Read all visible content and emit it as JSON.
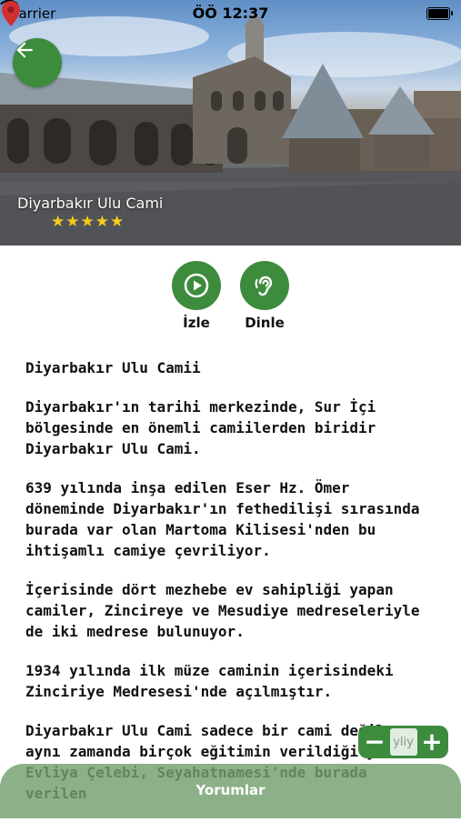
{
  "status_bar": {
    "carrier": "Carrier",
    "time": "ÖÖ 12:37"
  },
  "hero": {
    "place_name": "Diyarbakır Ulu Cami",
    "rating_stars": "★★★★★",
    "rating_value": 5,
    "icons": {
      "back": "arrow-left-icon",
      "location": "location-pin-icon"
    },
    "colors": {
      "accent": "#3d8b3d",
      "star": "#f5cc1a",
      "pin": "#d32f2f"
    }
  },
  "actions": [
    {
      "label": "İzle",
      "icon": "play-circle-icon"
    },
    {
      "label": "Dinle",
      "icon": "ear-icon"
    }
  ],
  "article": {
    "heading": "Diyarbakır Ulu Camii",
    "paragraphs": [
      "Diyarbakır'ın tarihi merkezinde, Sur İçi bölgesinde en önemli camiilerden biridir Diyarbakır Ulu Cami.",
      "639 yılında inşa edilen Eser Hz. Ömer döneminde Diyarbakır'ın fethedilişi sırasında burada var olan Martoma Kilisesi'nden bu ihtişamlı camiye çevriliyor.",
      "İçerisinde dört mezhebe ev sahipliği yapan camiler, Zincireye ve Mesudiye medreseleriyle de iki medrese bulunuyor.",
      "1934 yılında ilk müze caminin içerisindeki Zinciriye Medresesi'nde açılmıştır.",
      "Diyarbakır Ulu Cami sadece bir cami değil aynı zamanda birçok eğitimin verildiği yerdi. Evliya Çelebi, Seyahatnamesi'nde burada verilen"
    ]
  },
  "zoom": {
    "minus": "−",
    "plus": "+",
    "middle": "yliy"
  },
  "comments_button": {
    "label": "Yorumlar"
  }
}
